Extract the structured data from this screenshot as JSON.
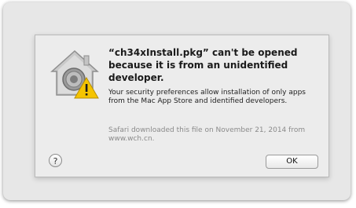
{
  "dialog": {
    "title": "“ch34xInstall.pkg” can't be opened because it is from an unidentified developer.",
    "message": "Your security preferences allow installation of only apps from the Mac App Store and identified developers.",
    "source_info": "Safari downloaded this file on November 21, 2014 from www.wch.cn.",
    "help_label": "?",
    "ok_label": "OK",
    "icon": "gatekeeper-warning-icon"
  }
}
